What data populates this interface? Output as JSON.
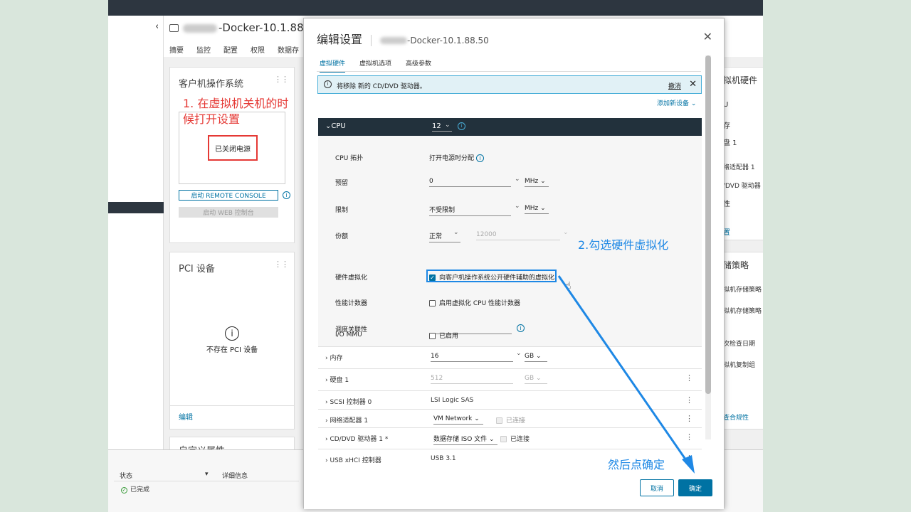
{
  "background": {
    "vm_title_suffix": "-Docker-10.1.88.50",
    "tabs": [
      "摘要",
      "监控",
      "配置",
      "权限",
      "数据存"
    ],
    "guest_os_card": {
      "title": "客户机操作系统",
      "power_state": "已关闭电源",
      "remote_console_label": "启动 REMOTE CONSOLE",
      "web_console_label": "启动 WEB 控制台"
    },
    "pci_card": {
      "title": "PCI 设备",
      "empty_text": "不存在 PCI 设备",
      "edit_link": "编辑"
    },
    "custom_attr_title": "自定义属性",
    "right_column": [
      "拟机硬件",
      "U",
      "存",
      "盘 1",
      "络适配器 1",
      "/DVD 驱动器 1",
      "性",
      "置",
      "储策略",
      "拟机存储策略",
      "拟机存储策略",
      "次检查日期",
      "拟机复制组",
      "查合规性"
    ],
    "tasks": {
      "col_status": "状态",
      "col_details": "详细信息",
      "row_status": "已完成"
    }
  },
  "annotations": {
    "step1": "1. 在虚拟机关机的时候打开设置",
    "step2": "2.勾选硬件虚拟化",
    "step3": "然后点确定"
  },
  "modal": {
    "title": "编辑设置",
    "vm_name_suffix": "-Docker-10.1.88.50",
    "tabs": [
      "虚拟硬件",
      "虚拟机选项",
      "高级参数"
    ],
    "alert": {
      "text": "将移除 新的 CD/DVD 驱动器。",
      "undo_label": "撤消"
    },
    "add_device_label": "添加新设备",
    "cpu": {
      "label": "CPU",
      "value": "12",
      "topology_label": "CPU 拓扑",
      "topology_value": "打开电源时分配",
      "reservation_label": "预留",
      "reservation_value": "0",
      "reservation_unit": "MHz",
      "limit_label": "限制",
      "limit_value": "不受限制",
      "limit_unit": "MHz",
      "shares_label": "份额",
      "shares_level": "正常",
      "shares_value": "12000",
      "hv_label": "硬件虚拟化",
      "hv_option": "向客户机操作系统公开硬件辅助的虚拟化",
      "hv_checked": true,
      "perf_label": "性能计数器",
      "perf_option": "启用虚拟化 CPU 性能计数器",
      "sched_label": "调度关联性",
      "sched_value": "",
      "iommu_label": "I/O MMU",
      "iommu_option": "已启用"
    },
    "devices": [
      {
        "label": "内存",
        "value": "16",
        "unit": "GB"
      },
      {
        "label": "硬盘 1",
        "value": "512",
        "unit": "GB"
      },
      {
        "label": "SCSI 控制器 0",
        "value": "LSI Logic SAS"
      },
      {
        "label": "网络适配器 1",
        "value": "VM Network",
        "extra": "已连接"
      },
      {
        "label": "CD/DVD 驱动器 1 *",
        "value": "数据存储 ISO 文件",
        "extra": "已连接"
      },
      {
        "label": "USB xHCI 控制器",
        "value": "USB 3.1"
      }
    ],
    "cancel_label": "取消",
    "ok_label": "确定"
  },
  "colors": {
    "accent": "#0072a3",
    "annotation_red": "#e53935",
    "annotation_blue": "#1e88e5",
    "cpu_header": "#22313c"
  }
}
